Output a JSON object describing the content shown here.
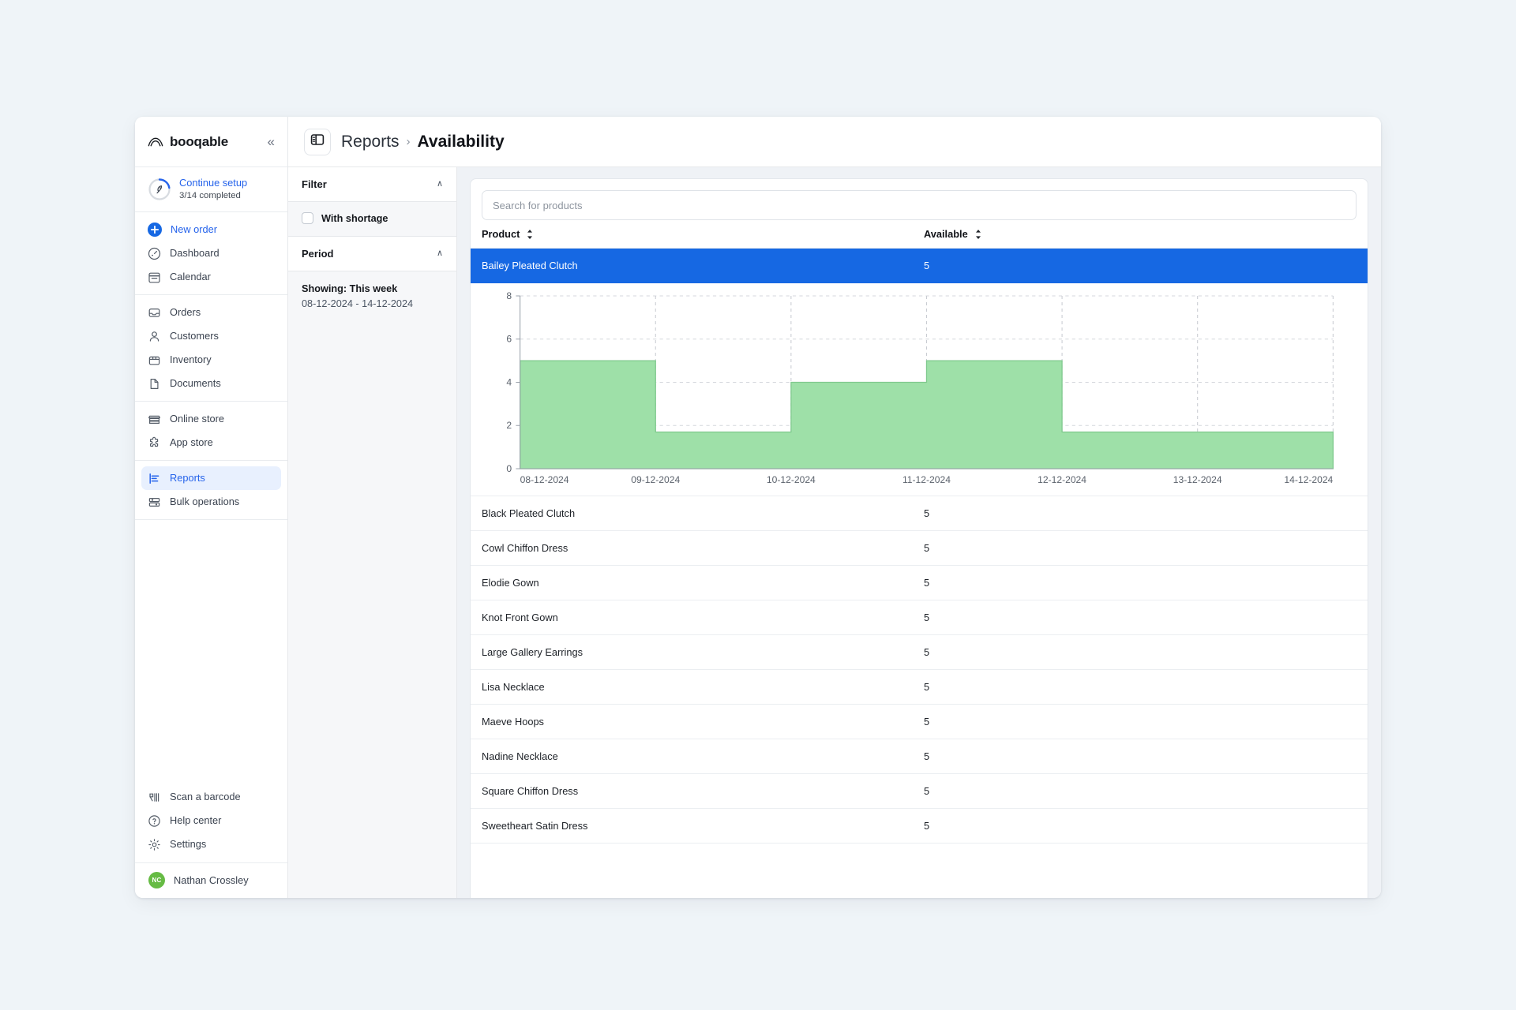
{
  "brand": {
    "name": "booqable",
    "collapse_label": "«"
  },
  "setup": {
    "title": "Continue setup",
    "subtitle": "3/14 completed",
    "progress": "3/14"
  },
  "sidebar": {
    "primary": [
      {
        "label": "New order",
        "icon": "plus-circle-icon"
      },
      {
        "label": "Dashboard",
        "icon": "gauge-icon"
      },
      {
        "label": "Calendar",
        "icon": "calendar-icon"
      }
    ],
    "secondary": [
      {
        "label": "Orders",
        "icon": "inbox-icon"
      },
      {
        "label": "Customers",
        "icon": "user-icon"
      },
      {
        "label": "Inventory",
        "icon": "box-icon"
      },
      {
        "label": "Documents",
        "icon": "document-icon"
      }
    ],
    "tertiary": [
      {
        "label": "Online store",
        "icon": "store-icon"
      },
      {
        "label": "App store",
        "icon": "puzzle-icon"
      }
    ],
    "quaternary": [
      {
        "label": "Reports",
        "icon": "bar-chart-icon"
      },
      {
        "label": "Bulk operations",
        "icon": "sliders-icon"
      }
    ],
    "bottom": [
      {
        "label": "Scan a barcode",
        "icon": "barcode-scanner-icon"
      },
      {
        "label": "Help center",
        "icon": "question-circle-icon"
      },
      {
        "label": "Settings",
        "icon": "gear-icon"
      }
    ],
    "user": {
      "name": "Nathan Crossley",
      "initials": "NC"
    }
  },
  "header": {
    "breadcrumb_parent": "Reports",
    "breadcrumb_separator": "›",
    "breadcrumb_current": "Availability"
  },
  "filter_panel": {
    "filter_title": "Filter",
    "filter_chevron": "∧",
    "shortage_label": "With shortage",
    "shortage_checked": false,
    "period_title": "Period",
    "period_chevron": "∧",
    "showing_label": "Showing: This week",
    "date_range": "08-12-2024 - 14-12-2024"
  },
  "search": {
    "placeholder": "Search for products",
    "value": ""
  },
  "table": {
    "columns": {
      "product": "Product",
      "available": "Available"
    },
    "selected_row": {
      "product": "Bailey Pleated Clutch",
      "available": "5"
    },
    "rows": [
      {
        "product": "Black Pleated Clutch",
        "available": "5"
      },
      {
        "product": "Cowl Chiffon Dress",
        "available": "5"
      },
      {
        "product": "Elodie Gown",
        "available": "5"
      },
      {
        "product": "Knot Front Gown",
        "available": "5"
      },
      {
        "product": "Large Gallery Earrings",
        "available": "5"
      },
      {
        "product": "Lisa Necklace",
        "available": "5"
      },
      {
        "product": "Maeve Hoops",
        "available": "5"
      },
      {
        "product": "Nadine Necklace",
        "available": "5"
      },
      {
        "product": "Square Chiffon Dress",
        "available": "5"
      },
      {
        "product": "Sweetheart Satin Dress",
        "available": "5"
      }
    ]
  },
  "colors": {
    "accent": "#1668e3",
    "link": "#2563eb",
    "chart_fill": "#9ee0a8",
    "chart_line": "#7fc98d",
    "avatar": "#66bb44",
    "page_bg": "#eff4f8"
  },
  "chart_data": {
    "type": "area",
    "step": "post",
    "title": "",
    "xlabel": "",
    "ylabel": "",
    "x": [
      "08-12-2024",
      "09-12-2024",
      "10-12-2024",
      "11-12-2024",
      "12-12-2024",
      "13-12-2024",
      "14-12-2024"
    ],
    "values": [
      0,
      5,
      1.7,
      4,
      5,
      1.7,
      1.7
    ],
    "ylim": [
      0,
      8
    ],
    "yticks": [
      0,
      2,
      4,
      6,
      8
    ],
    "ytick_labels": [
      "0",
      "2",
      "4",
      "6",
      "8"
    ],
    "xtick_labels": [
      "08-12-2024",
      "09-12-2024",
      "10-12-2024",
      "11-12-2024",
      "12-12-2024",
      "13-12-2024",
      "14-12-2024"
    ],
    "grid": true,
    "legend": "none",
    "series": [
      {
        "name": "Available",
        "values": [
          0,
          5,
          1.7,
          4,
          5,
          1.7,
          1.7
        ]
      }
    ]
  }
}
